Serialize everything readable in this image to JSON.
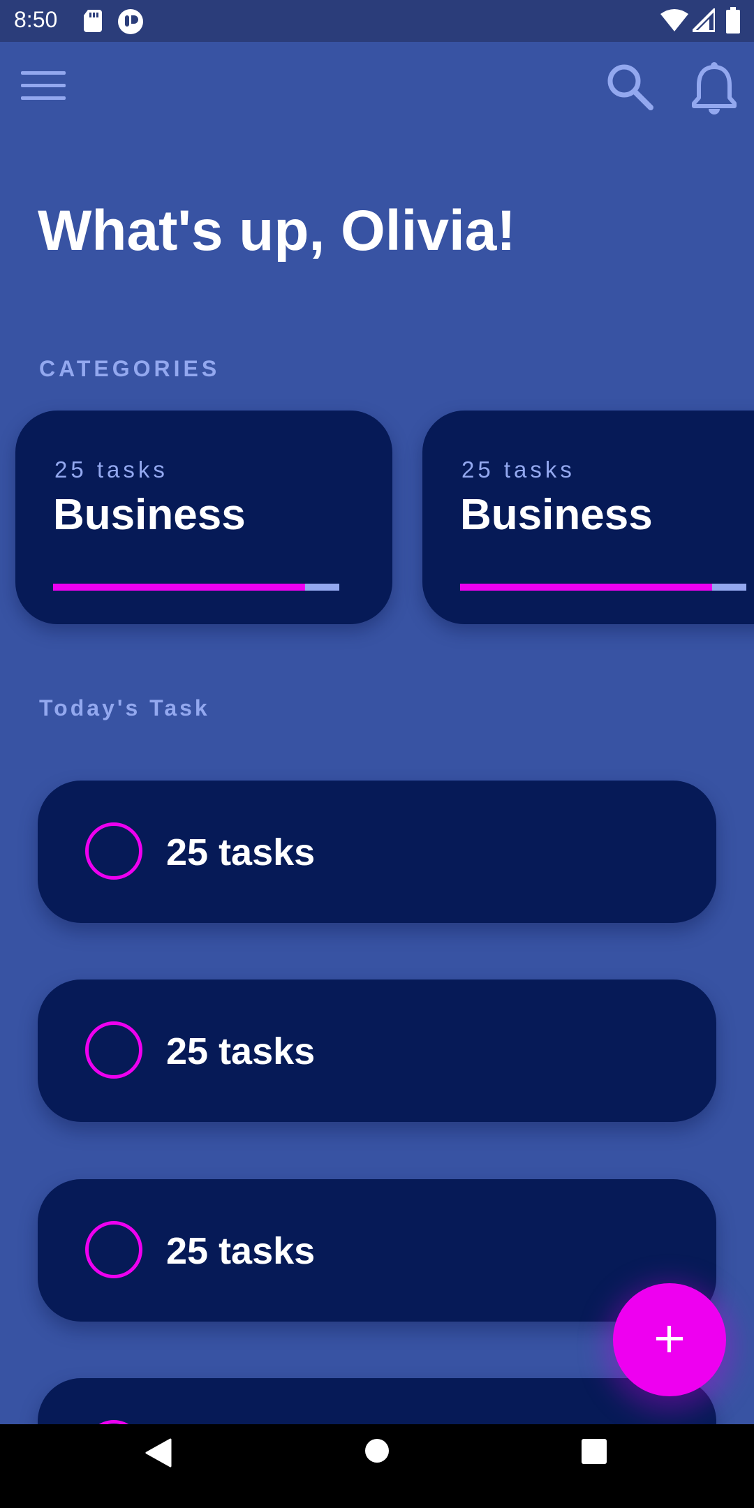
{
  "status_bar": {
    "time": "8:50",
    "icons": [
      "sd-card-icon",
      "app-notification-icon",
      "wifi-icon",
      "signal-icon",
      "battery-icon"
    ]
  },
  "app_bar": {
    "icons": [
      "menu-icon",
      "search-icon",
      "bell-icon"
    ]
  },
  "greeting": "What's up, Olivia!",
  "categories": {
    "label": "CATEGORIES",
    "items": [
      {
        "count": "25 tasks",
        "name": "Business",
        "progress": 0.88
      },
      {
        "count": "25 tasks",
        "name": "Business",
        "progress": 0.88
      }
    ]
  },
  "today": {
    "label": "Today's Task",
    "tasks": [
      {
        "label": "25 tasks"
      },
      {
        "label": "25 tasks"
      },
      {
        "label": "25 tasks"
      }
    ]
  },
  "fab": {
    "icon": "plus-icon"
  },
  "nav_bar": {
    "icons": [
      "back-icon",
      "home-icon",
      "recents-icon"
    ]
  },
  "colors": {
    "background": "#3853a3",
    "card": "#061a57",
    "accent": "#ee00f0",
    "muted": "#93a8ef",
    "status_bar": "#2b3d7a"
  }
}
